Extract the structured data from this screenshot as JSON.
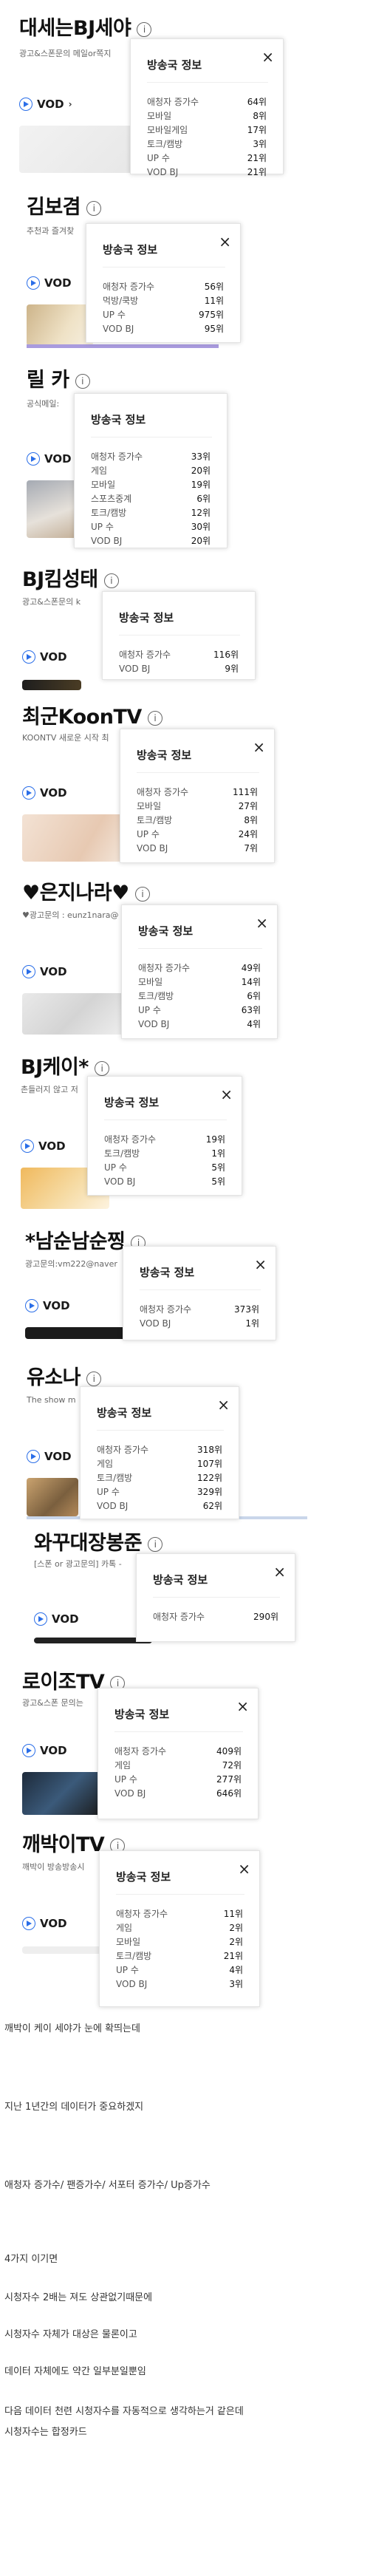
{
  "popup_title": "방송국 정보",
  "vod_label": "VOD",
  "streamers": [
    {
      "name": "대세는BJ세야",
      "desc": "광고&스폰문의 메일or쪽지",
      "rows": [
        {
          "k": "애청자 증가수",
          "v": "64위"
        },
        {
          "k": "모바일",
          "v": "8위"
        },
        {
          "k": "모바일게임",
          "v": "17위"
        },
        {
          "k": "토크/캠방",
          "v": "3위"
        },
        {
          "k": "UP 수",
          "v": "21위"
        },
        {
          "k": "VOD BJ",
          "v": "21위"
        }
      ]
    },
    {
      "name": "김보겸",
      "desc": "추천과 즐겨찾",
      "rows": [
        {
          "k": "애청자 증가수",
          "v": "56위"
        },
        {
          "k": "먹방/쿡방",
          "v": "11위"
        },
        {
          "k": "UP 수",
          "v": "975위"
        },
        {
          "k": "VOD BJ",
          "v": "95위"
        }
      ]
    },
    {
      "name": "릴 카",
      "desc": "공식메일:",
      "rows": [
        {
          "k": "애청자 증가수",
          "v": "33위"
        },
        {
          "k": "게임",
          "v": "20위"
        },
        {
          "k": "모바일",
          "v": "19위"
        },
        {
          "k": "스포츠중계",
          "v": "6위"
        },
        {
          "k": "토크/캠방",
          "v": "12위"
        },
        {
          "k": "UP 수",
          "v": "30위"
        },
        {
          "k": "VOD BJ",
          "v": "20위"
        }
      ]
    },
    {
      "name": "BJ킴성태",
      "desc": "광고&스폰문의 k",
      "rows": [
        {
          "k": "애청자 증가수",
          "v": "116위"
        },
        {
          "k": "VOD BJ",
          "v": "9위"
        }
      ]
    },
    {
      "name": "최군KoonTV",
      "desc": "KOONTV 새로운 시작 최",
      "rows": [
        {
          "k": "애청자 증가수",
          "v": "111위"
        },
        {
          "k": "모바일",
          "v": "27위"
        },
        {
          "k": "토크/캠방",
          "v": "8위"
        },
        {
          "k": "UP 수",
          "v": "24위"
        },
        {
          "k": "VOD BJ",
          "v": "7위"
        }
      ]
    },
    {
      "name": "♥은지나라♥",
      "desc": "♥광고문의 : eunz1nara@",
      "rows": [
        {
          "k": "애청자 증가수",
          "v": "49위"
        },
        {
          "k": "모바일",
          "v": "14위"
        },
        {
          "k": "토크/캠방",
          "v": "6위"
        },
        {
          "k": "UP 수",
          "v": "63위"
        },
        {
          "k": "VOD BJ",
          "v": "4위"
        }
      ]
    },
    {
      "name": "BJ케이*",
      "desc": "촌들러지 않고 저",
      "rows": [
        {
          "k": "애청자 증가수",
          "v": "19위"
        },
        {
          "k": "토크/캠방",
          "v": "1위"
        },
        {
          "k": "UP 수",
          "v": "5위"
        },
        {
          "k": "VOD BJ",
          "v": "5위"
        }
      ]
    },
    {
      "name": "*남순남순찡",
      "desc": "광고문의:vm222@naver",
      "rows": [
        {
          "k": "애청자 증가수",
          "v": "373위"
        },
        {
          "k": "VOD BJ",
          "v": "1위"
        }
      ]
    },
    {
      "name": "유소나",
      "desc": "The show m",
      "rows": [
        {
          "k": "애청자 증가수",
          "v": "318위"
        },
        {
          "k": "게임",
          "v": "107위"
        },
        {
          "k": "토크/캠방",
          "v": "122위"
        },
        {
          "k": "UP 수",
          "v": "329위"
        },
        {
          "k": "VOD BJ",
          "v": "62위"
        }
      ]
    },
    {
      "name": "와꾸대장봉준",
      "desc": "[스폰 or 광고문의] 카톡 -",
      "rows": [
        {
          "k": "애청자 증가수",
          "v": "290위"
        }
      ]
    },
    {
      "name": "로이조TV",
      "desc": "광고&스폰 문의는",
      "rows": [
        {
          "k": "애청자 증가수",
          "v": "409위"
        },
        {
          "k": "게임",
          "v": "72위"
        },
        {
          "k": "UP 수",
          "v": "277위"
        },
        {
          "k": "VOD BJ",
          "v": "646위"
        }
      ]
    },
    {
      "name": "깨박이TV",
      "desc": "깨박이 방송방송시",
      "rows": [
        {
          "k": "애청자 증가수",
          "v": "11위"
        },
        {
          "k": "게임",
          "v": "2위"
        },
        {
          "k": "모바일",
          "v": "2위"
        },
        {
          "k": "토크/캠방",
          "v": "21위"
        },
        {
          "k": "UP 수",
          "v": "4위"
        },
        {
          "k": "VOD BJ",
          "v": "3위"
        }
      ]
    }
  ],
  "post_text": [
    "깨박이 케이 세야가 눈에 확띄는데",
    "지난 1년간의 데이터가 중요하겠지",
    "애청자 증가수/ 팬증가수/ 서포터 증가수/ Up증가수",
    "4가지 이기면",
    "시청자수 2배는 져도 상관없기때문에",
    "시청자수 자체가 대상은 물론이고",
    "데이터 자체에도 약간 일부분일뿐임",
    "다음 데이터 천련 시청자수를 자동적으로 생각하는거 같은데",
    "시청자수는 합정카드"
  ]
}
